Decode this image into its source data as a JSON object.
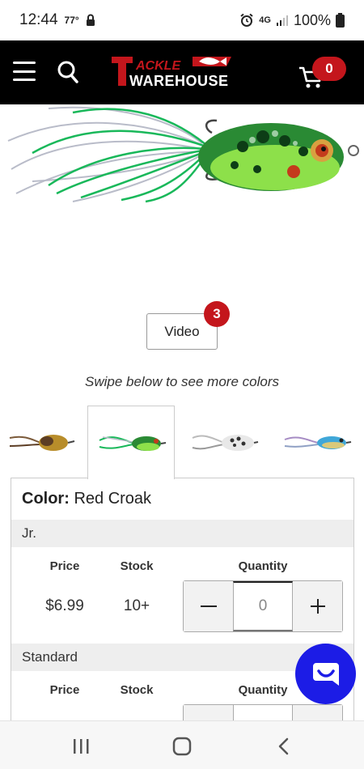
{
  "status_bar": {
    "time": "12:44",
    "temp": "77°",
    "network": "4G",
    "battery": "100%"
  },
  "header": {
    "cart_count": "0",
    "logo_line1": "ACKLE",
    "logo_line2": "WAREHOUSE",
    "logo_letter": "T"
  },
  "product": {
    "video_label": "Video",
    "video_count": "3",
    "swipe_hint": "Swipe below to see more colors"
  },
  "color_section": {
    "label": "Color:",
    "value": "Red Croak",
    "sizes": [
      {
        "name": "Jr.",
        "price_header": "Price",
        "stock_header": "Stock",
        "quantity_header": "Quantity",
        "price": "$6.99",
        "stock": "10+",
        "quantity": "0"
      },
      {
        "name": "Standard",
        "price_header": "Price",
        "stock_header": "Stock",
        "quantity_header": "Quantity"
      }
    ]
  },
  "colors": {
    "brand_red": "#c4161c",
    "header_bg": "#000000",
    "chat_blue": "#1c1ce6"
  }
}
